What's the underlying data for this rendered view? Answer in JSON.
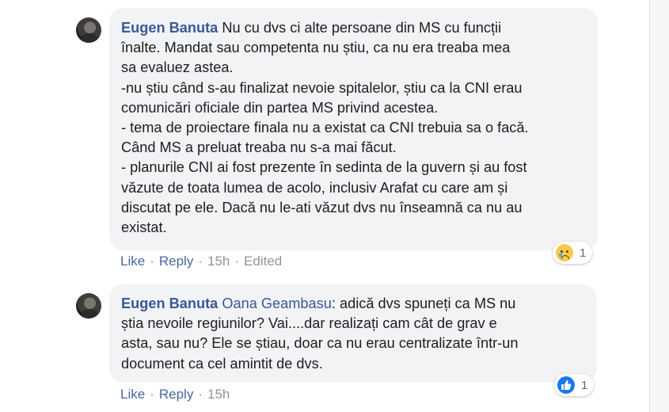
{
  "comments": [
    {
      "author": "Eugen Banuta",
      "mention": "",
      "lines": [
        " Nu cu dvs ci alte persoane din MS cu funcții",
        "înalte. Mandat sau competenta nu știu, ca nu era treaba mea",
        "sa evaluez astea.",
        "-nu știu când s-au finalizat nevoie spitalelor, știu ca la CNI erau",
        "comunicări oficiale din partea MS privind acestea.",
        "- tema de proiectare finala nu a existat ca CNI trebuia sa o facă.",
        "Când MS a preluat treaba nu s-a mai făcut.",
        "- planurile CNI ai fost prezente în sedinta de la guvern și au fost",
        "văzute de toata lumea de acolo, inclusiv Arafat cu care am și",
        "discutat pe ele. Dacă nu le-ati văzut dvs nu înseamnă ca nu au",
        "existat."
      ],
      "actions": {
        "like": "Like",
        "reply": "Reply",
        "time": "15h",
        "edited": "Edited"
      },
      "reaction": {
        "icon": "sad-reaction-icon",
        "count": "1"
      }
    },
    {
      "author": "Eugen Banuta",
      "mention": "Oana Geambasu",
      "lines": [
        ": adică dvs spuneți ca MS nu",
        "știa nevoile regiunilor? Vai....dar realizați cam cât de grav e",
        "asta, sau nu? Ele se știau, doar ca nu erau centralizate într-un",
        "document ca cel amintit de dvs."
      ],
      "actions": {
        "like": "Like",
        "reply": "Reply",
        "time": "15h"
      },
      "reaction": {
        "icon": "like-reaction-icon",
        "count": "1"
      }
    }
  ],
  "separator": "·",
  "colors": {
    "link": "#385898",
    "meta": "#90949c",
    "bubble": "#f2f3f5",
    "like_blue": "#1877f2",
    "sad_yellow": "#f7c94a"
  }
}
